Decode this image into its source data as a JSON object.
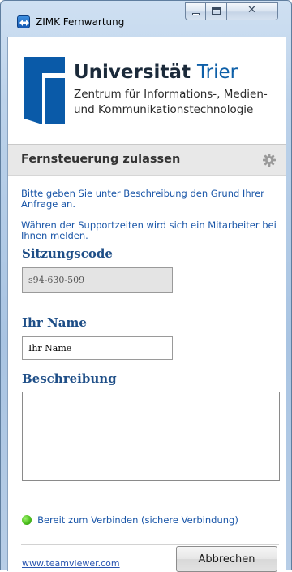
{
  "window": {
    "title": "ZIMK Fernwartung",
    "close_glyph": "✕"
  },
  "header": {
    "logo_icon": "university-trier-logo",
    "university_name_main": "Universität",
    "university_name_accent": "Trier",
    "subtitle_line1": "Zentrum für Informations-, Medien-",
    "subtitle_line2": "und Kommunikationstechnologie"
  },
  "section": {
    "title": "Fernsteuerung zulassen",
    "settings_icon": "gear-icon"
  },
  "info": {
    "text1": "Bitte geben Sie unter Beschreibung den Grund Ihrer Anfrage an.",
    "text2": "Währen der Supportzeiten wird sich ein Mitarbeiter bei Ihnen melden."
  },
  "form": {
    "session_label": "Sitzungscode",
    "session_value": "s94-630-509",
    "name_label": "Ihr Name",
    "name_value": "Ihr Name",
    "description_label": "Beschreibung",
    "description_value": ""
  },
  "status": {
    "text": "Bereit zum Verbinden (sichere Verbindung)",
    "color": "#4dbf1e"
  },
  "footer": {
    "link_text": "www.teamviewer.com",
    "cancel_label": "Abbrechen"
  },
  "colors": {
    "accent_blue": "#1a56a8",
    "label_blue": "#1e4e87",
    "brand_blue": "#0d5fa8"
  }
}
